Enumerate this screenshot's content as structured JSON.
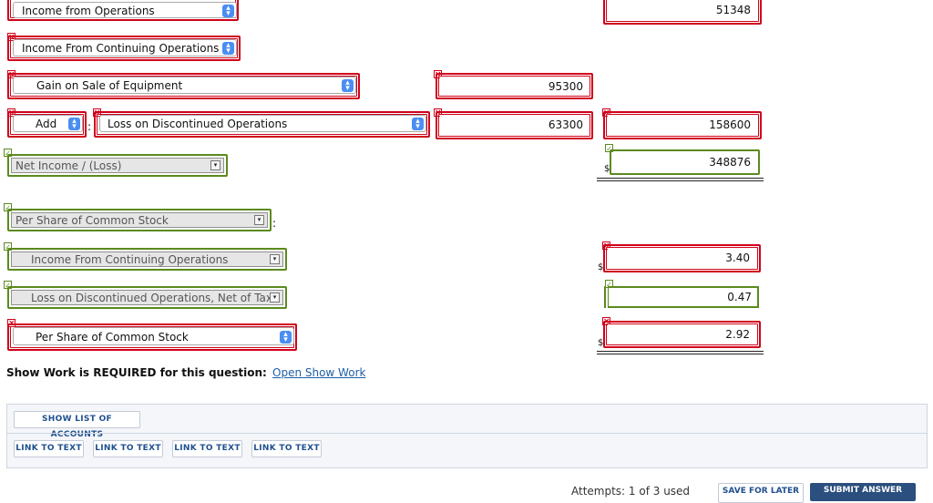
{
  "rows": {
    "income_operations": {
      "label": "Income from Operations",
      "value": "51348"
    },
    "continuing_operations": {
      "label": "Income From Continuing Operations"
    },
    "gain_sale": {
      "label": "Gain on Sale of Equipment",
      "value": "95300"
    },
    "discontinued": {
      "operator": "Add",
      "label": "Loss on Discontinued Operations",
      "value": "63300",
      "total": "158600"
    },
    "net_income": {
      "label": "Net Income / (Loss)",
      "currency": "$",
      "value": "348876"
    },
    "per_share_header": {
      "label": "Per Share of Common Stock",
      "suffix": ":"
    },
    "eps_continuing": {
      "label": "Income From Continuing Operations",
      "currency": "$",
      "value": "3.40"
    },
    "eps_discontinued": {
      "label": "Loss on Discontinued Operations, Net of Tax",
      "value": "0.47"
    },
    "eps_total": {
      "label": "Per Share of Common Stock",
      "currency": "$",
      "value": "2.92"
    }
  },
  "show_work": {
    "text": "Show Work is REQUIRED for this question:",
    "link": "Open Show Work"
  },
  "panel": {
    "show_list_label": "SHOW LIST OF ACCOUNTS",
    "links": [
      "LINK TO TEXT",
      "LINK TO TEXT",
      "LINK TO TEXT",
      "LINK TO TEXT"
    ]
  },
  "footer": {
    "attempts": "Attempts: 1 of 3 used",
    "save_label": "SAVE FOR LATER",
    "submit_label": "SUBMIT ANSWER"
  },
  "colors": {
    "incorrect": "#d0021b",
    "correct": "#5b8a1e",
    "select_arrow": "#4a8ef4",
    "submit_bg": "#2b4f7e"
  }
}
